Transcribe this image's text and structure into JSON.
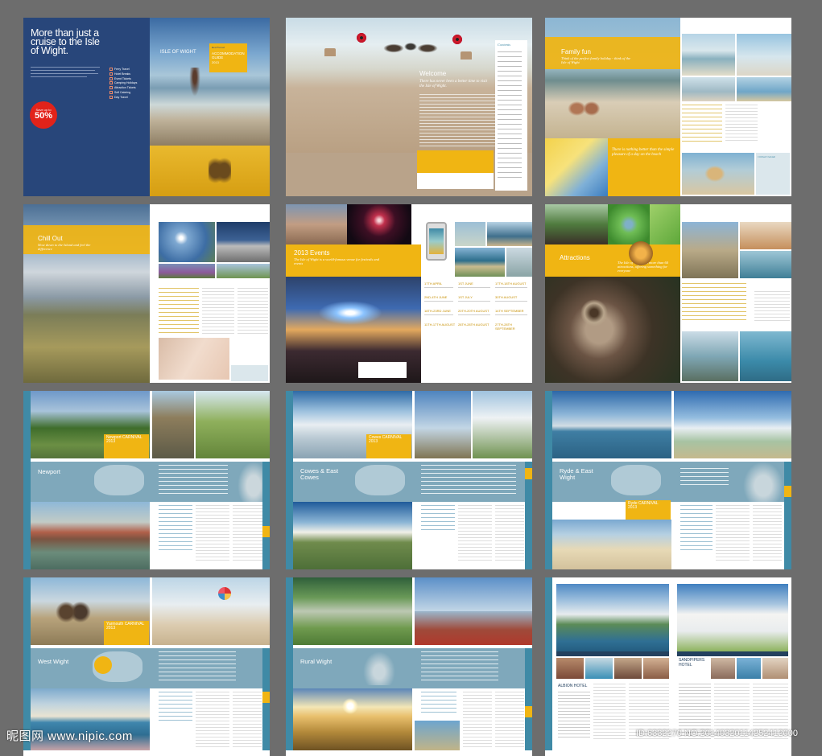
{
  "s1": {
    "headline": "More than just a cruise to the Isle of Wight.",
    "badge_top": "Save up to",
    "badge_pct": "50%",
    "cover_label": "ISLE OF WIGHT",
    "guide_brand": "Red Funnel",
    "guide_title": "ACCOMMODATION GUIDE",
    "guide_year": "2013",
    "menu": [
      "Ferry Travel",
      "Hotel Breaks",
      "Event Tickets",
      "Camping Holidays",
      "Attraction Tickets",
      "Self Catering",
      "Day Travel"
    ]
  },
  "s2": {
    "title": "Welcome",
    "intro": "There has never been a better time to visit the Isle of Wight.",
    "contents": "Contents"
  },
  "s3": {
    "title": "Family fun",
    "sub": "Think of the perfect family holiday - think of the Isle of Wight",
    "quote": "There is nothing better than the simple pleasure of a day on the beach",
    "side": "Chilled Outside"
  },
  "s4": {
    "title": "Chill Out",
    "sub": "Slow down to the Island and feel the difference"
  },
  "s5": {
    "title": "2013 Events",
    "sub": "The Isle of Wight is a world-famous venue for festivals and events",
    "events_left": [
      "17TH APRIL",
      "2ND-4TH JUNE",
      "18TH-23RD JUNE",
      "11TH-17TH AUGUST"
    ],
    "events_mid": [
      "1ST JUNE",
      "1ST JULY",
      "20TH-20TH AUGUST",
      "28TH-28TH AUGUST"
    ],
    "events_right": [
      "17TH-18TH AUGUST",
      "30TH AUGUST",
      "14TH SEPTEMBER",
      "27TH-28TH SEPTEMBER"
    ]
  },
  "s6": {
    "title": "Attractions",
    "sub": "The Isle of Wight has more than 60 attractions, offering something for everyone"
  },
  "s7": {
    "title": "Newport",
    "carnival": "Newport CARNIVAL 2013"
  },
  "s8": {
    "title": "Cowes & East Cowes",
    "carnival": "Cowes CARNIVAL 2013"
  },
  "s9": {
    "title": "Ryde & East Wight",
    "carnival": "Ryde CARNIVAL 2013"
  },
  "s10": {
    "title": "West Wight",
    "carnival": "Yarmouth CARNIVAL 2013"
  },
  "s11": {
    "title": "Rural Wight"
  },
  "s12": {
    "hotel1": "ALBION HOTEL",
    "hotel2": "SANDPIPERS HOTEL"
  },
  "watermark": {
    "logo": "昵图网 www.nipic.com",
    "id": "ID:6332270 NO:20140320114252412000"
  },
  "colors": {
    "navy": "#28467a",
    "yellow": "#f0b513",
    "teal": "#7fa8bb",
    "sidebar": "#3f8aa6",
    "red": "#e2231a"
  }
}
